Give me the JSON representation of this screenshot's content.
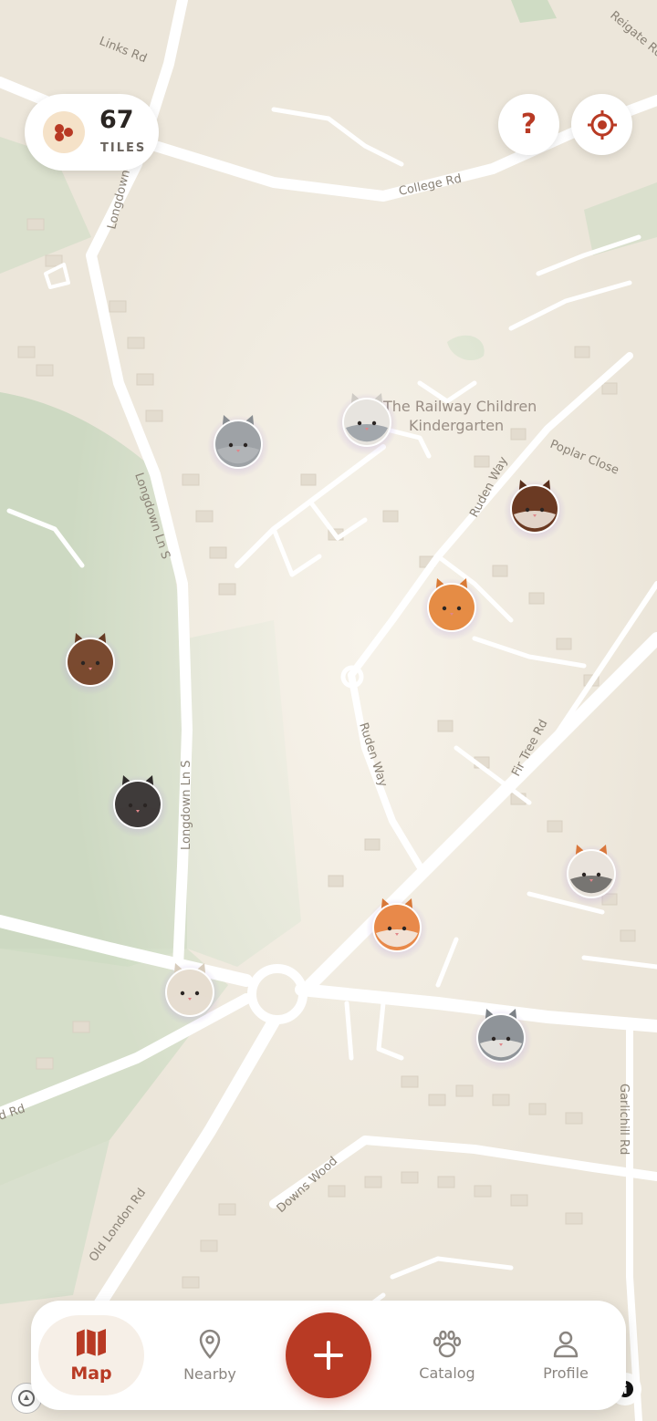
{
  "tiles": {
    "count": "67",
    "label": "TILES"
  },
  "help_button": {
    "glyph": "?"
  },
  "map": {
    "labels": {
      "links_rd": "Links Rd",
      "reigate_rd": "Reigate Rd",
      "college_rd": "College Rd",
      "longdown_ln_s_top": "Longdown Ln S",
      "longdown_ln_s_mid": "Longdown Ln S",
      "longdown_ln_s_low": "Longdown Ln S",
      "railway_children_line1": "The Railway Children",
      "railway_children_line2": "Kindergarten",
      "poplar_close": "Poplar Close",
      "ruden_way_top": "Ruden Way",
      "ruden_way_mid": "Ruden Way",
      "fir_tree_rd": "Fir Tree Rd",
      "downs_wood": "Downs Wood",
      "old_london_rd": "Old London Rd",
      "garlichill_rd": "Garlichill Rd",
      "d_rd": "d Rd"
    }
  },
  "cats": [
    {
      "id": "grey-tabby",
      "body": "#9ea2a6",
      "ear": "#8a8e92",
      "face": "#b3b6b9"
    },
    {
      "id": "white-grey",
      "body": "#e7e4df",
      "ear": "#cfcbc5",
      "face": "#9aa0a6"
    },
    {
      "id": "calico-brown",
      "body": "#6b3a23",
      "ear": "#5a2f1c",
      "face": "#efe6dc"
    },
    {
      "id": "orange-tabby",
      "body": "#e58c45",
      "ear": "#d97a35",
      "face": "#e58c45"
    },
    {
      "id": "brown-tabby",
      "body": "#7a4a30",
      "ear": "#663b24",
      "face": "#7a4a30"
    },
    {
      "id": "black",
      "body": "#3f3b3a",
      "ear": "#2f2b2a",
      "face": "#3f3b3a"
    },
    {
      "id": "calico-white",
      "body": "#e9e3dc",
      "ear": "#d9773b",
      "face": "#6a6866"
    },
    {
      "id": "orange-white",
      "body": "#e8894a",
      "ear": "#d87838",
      "face": "#f3ece4"
    },
    {
      "id": "cream",
      "body": "#e6ddd0",
      "ear": "#d8cdbd",
      "face": "#e6ddd0"
    },
    {
      "id": "grey-white",
      "body": "#8f9499",
      "ear": "#7c8186",
      "face": "#ece9e4"
    }
  ],
  "nav": {
    "items": [
      {
        "label": "Map",
        "icon": "map-icon",
        "active": true
      },
      {
        "label": "Nearby",
        "icon": "location-pin-icon"
      },
      {
        "label": "Catalog",
        "icon": "paw-icon"
      },
      {
        "label": "Profile",
        "icon": "person-icon"
      }
    ],
    "add_button_icon": "plus-icon"
  },
  "colors": {
    "accent": "#b83a24",
    "map_bg": "#efe9de",
    "park_green": "#c9d8bf",
    "road": "#ffffff"
  }
}
